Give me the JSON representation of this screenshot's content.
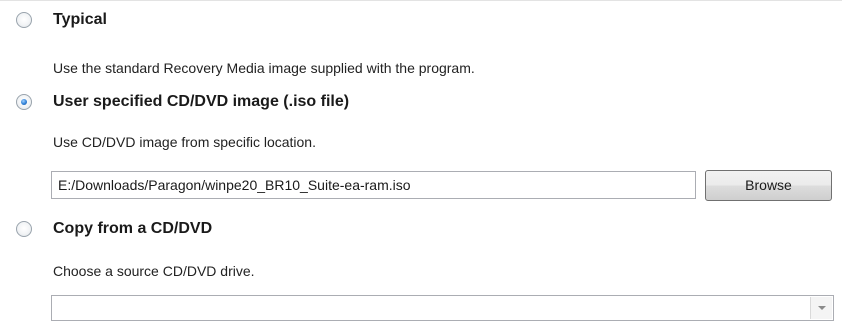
{
  "options": {
    "typical": {
      "label": "Typical",
      "description": "Use the standard Recovery Media image supplied with the program.",
      "selected": false
    },
    "iso": {
      "label": "User specified CD/DVD image (.iso file)",
      "description": "Use CD/DVD image from specific location.",
      "selected": true,
      "path_value": "E:/Downloads/Paragon/winpe20_BR10_Suite-ea-ram.iso",
      "browse_label": "Browse"
    },
    "copy": {
      "label": "Copy from a CD/DVD",
      "description": "Choose a source CD/DVD drive.",
      "selected": false,
      "drive_value": ""
    }
  },
  "icons": {
    "radio": "radio-button-icon",
    "dropdown": "chevron-down-icon"
  },
  "colors": {
    "radio_selected": "#2d7fd6",
    "border": "#abadb3"
  }
}
